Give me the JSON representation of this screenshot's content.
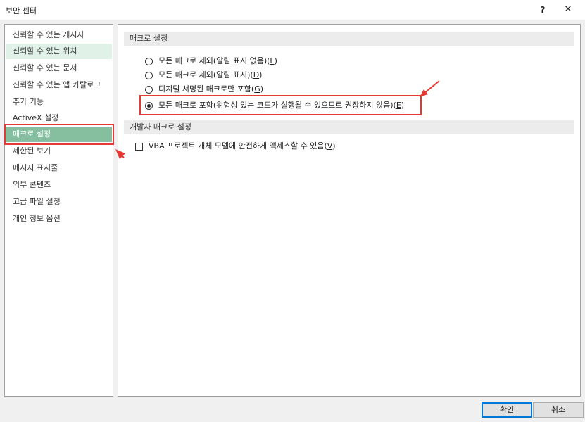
{
  "window": {
    "title": "보안 센터",
    "help_label": "?",
    "close_label": "✕"
  },
  "sidebar": {
    "items": [
      {
        "label": "신뢰할 수 있는 게시자"
      },
      {
        "label": "신뢰할 수 있는 위치"
      },
      {
        "label": "신뢰할 수 있는 문서"
      },
      {
        "label": "신뢰할 수 있는 앱 카탈로그"
      },
      {
        "label": "추가 기능"
      },
      {
        "label": "ActiveX 설정"
      },
      {
        "label": "매크로 설정"
      },
      {
        "label": "제한된 보기"
      },
      {
        "label": "메시지 표시줄"
      },
      {
        "label": "외부 콘텐츠"
      },
      {
        "label": "고급 파일 설정"
      },
      {
        "label": "개인 정보 옵션"
      }
    ],
    "hovered_item": "신뢰할 수 있는 위치",
    "selected_item": "매크로 설정"
  },
  "macro_settings": {
    "header": "매크로 설정",
    "options": [
      {
        "label": "모든 매크로 제외(알림 표시 없음)(",
        "key": "L",
        "suffix": ")",
        "checked": false
      },
      {
        "label": "모든 매크로 제외(알림 표시)(",
        "key": "D",
        "suffix": ")",
        "checked": false
      },
      {
        "label": "디지털 서명된 매크로만 포함(",
        "key": "G",
        "suffix": ")",
        "checked": false
      },
      {
        "label": "모든 매크로 포함(위험성 있는 코드가 실행될 수 있으므로 권장하지 않음)(",
        "key": "E",
        "suffix": ")",
        "checked": true
      }
    ]
  },
  "developer_macro_settings": {
    "header": "개발자 매크로 설정",
    "vba_label": "VBA 프로젝트 개체 모델에 안전하게 액세스할 수 있음(",
    "vba_key": "V",
    "vba_suffix": ")",
    "vba_checked": false
  },
  "buttons": {
    "ok": "확인",
    "cancel": "취소"
  },
  "colors": {
    "selected_bg": "#86bfa0",
    "hover_bg": "#e0f1e7",
    "annotation_red": "#e53935"
  }
}
